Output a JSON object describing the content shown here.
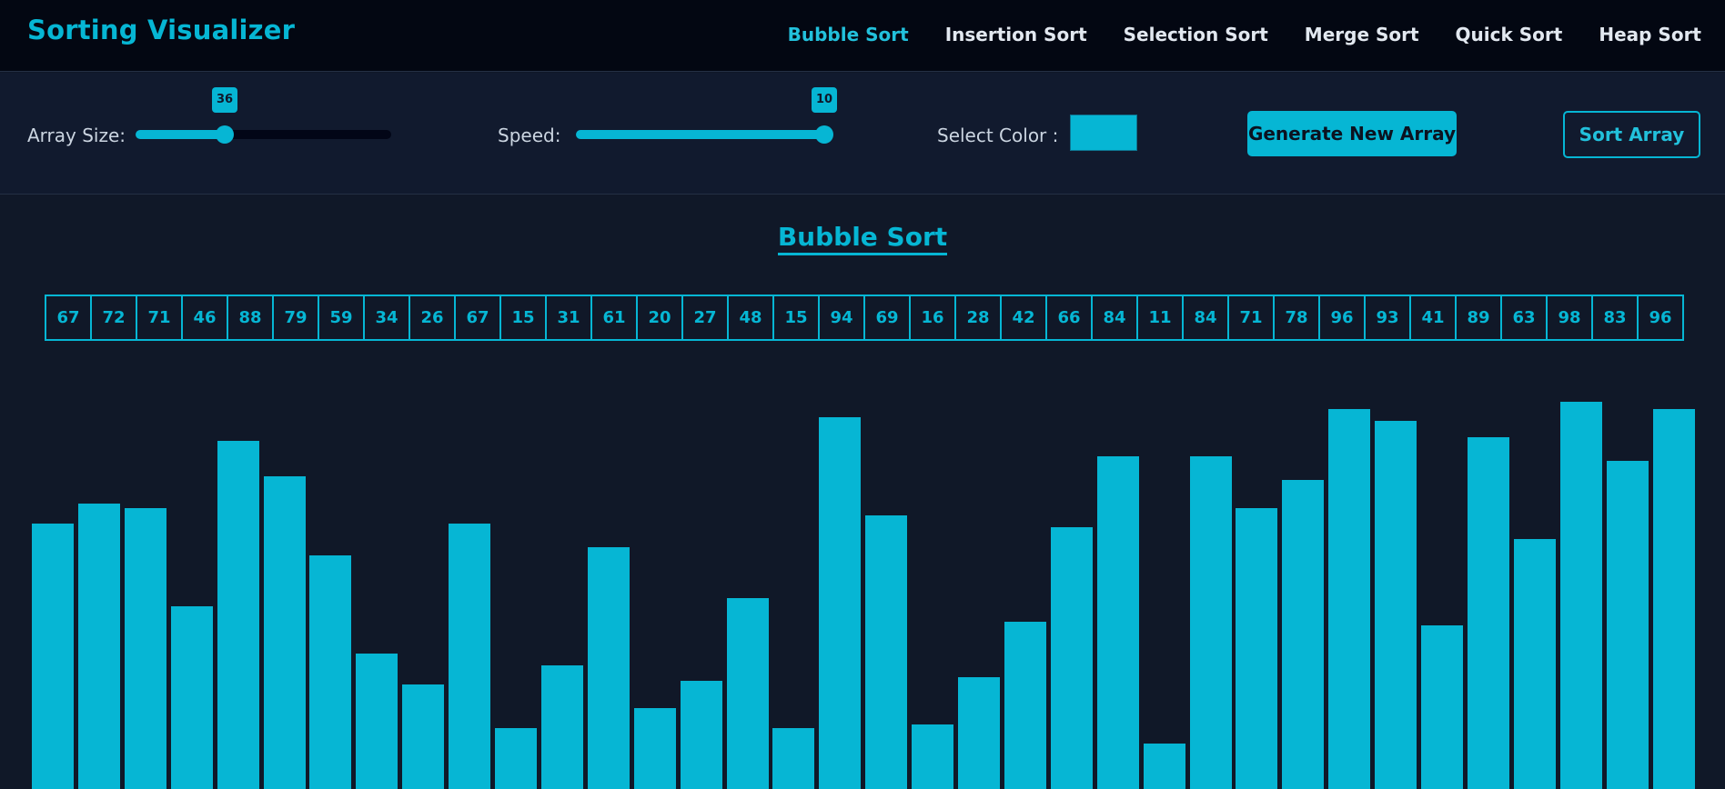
{
  "app": {
    "title": "Sorting Visualizer"
  },
  "nav": {
    "items": [
      {
        "label": "Bubble Sort",
        "active": true
      },
      {
        "label": "Insertion Sort",
        "active": false
      },
      {
        "label": "Selection Sort",
        "active": false
      },
      {
        "label": "Merge Sort",
        "active": false
      },
      {
        "label": "Quick Sort",
        "active": false
      },
      {
        "label": "Heap Sort",
        "active": false
      }
    ]
  },
  "controls": {
    "array_size": {
      "label": "Array Size:",
      "value": "36",
      "fraction": 0.35
    },
    "speed": {
      "label": "Speed:",
      "value": "10",
      "fraction": 0.97
    },
    "color": {
      "label": "Select Color :",
      "value": "#06b6d4"
    },
    "generate_label": "Generate New Array",
    "sort_label": "Sort Array"
  },
  "main": {
    "algorithm_title": "Bubble Sort",
    "array_values": [
      67,
      72,
      71,
      46,
      88,
      79,
      59,
      34,
      26,
      67,
      15,
      31,
      61,
      20,
      27,
      48,
      15,
      94,
      69,
      16,
      28,
      42,
      66,
      84,
      11,
      84,
      71,
      78,
      96,
      93,
      41,
      89,
      63,
      98,
      83,
      96
    ]
  },
  "colors": {
    "accent": "#06b6d4",
    "header_bg": "#030712",
    "page_bg": "#101828"
  }
}
